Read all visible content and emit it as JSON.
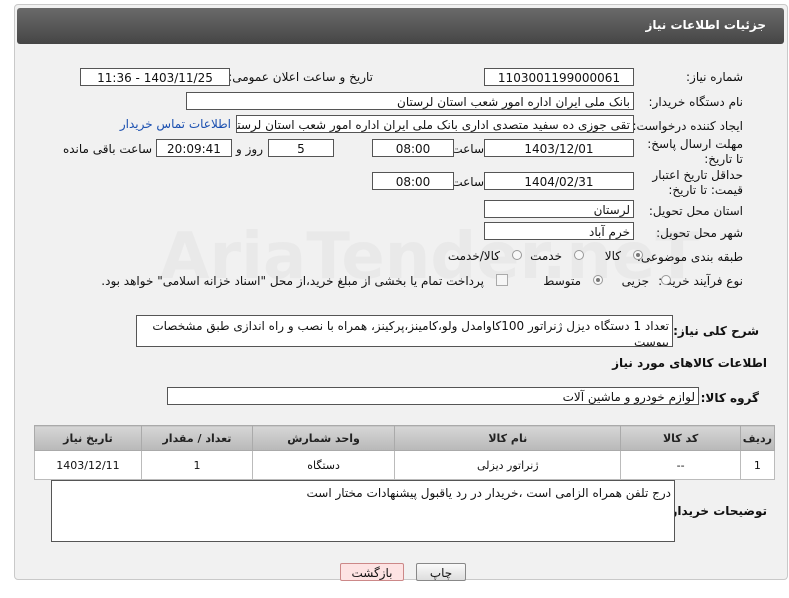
{
  "header": {
    "title": "جزئیات اطلاعات نیاز"
  },
  "fields": {
    "need_number_label": "شماره نیاز:",
    "need_number": "1103001199000061",
    "announce_label": "تاریخ و ساعت اعلان عمومی:",
    "announce_value": "1403/11/25 - 11:36",
    "buyer_org_label": "نام دستگاه خریدار:",
    "buyer_org": "بانک ملی ایران اداره امور شعب استان لرستان",
    "requester_label": "ایجاد کننده درخواست:",
    "requester": "تقی جوزی ده سفید متصدی اداری بانک ملی ایران اداره امور شعب استان لرستان",
    "contact_link": "اطلاعات تماس خریدار",
    "deadline_label": "مهلت ارسال پاسخ: تا تاریخ:",
    "deadline_date": "1403/12/01",
    "time_label": "ساعت",
    "deadline_time": "08:00",
    "days_value": "5",
    "days_label": "روز و",
    "remaining_time": "20:09:41",
    "remaining_label": "ساعت باقی مانده",
    "min_validity_label": "حداقل تاریخ اعتبار قیمت: تا تاریخ:",
    "validity_date": "1404/02/31",
    "validity_time": "08:00",
    "province_label": "استان محل تحویل:",
    "province": "لرستان",
    "city_label": "شهر محل تحویل:",
    "city": "خرم آباد",
    "category_label": "طبقه بندی موضوعی:",
    "category_options": [
      "کالا",
      "خدمت",
      "کالا/خدمت"
    ],
    "purchase_type_label": "نوع فرآیند خرید :",
    "purchase_options": [
      "جزیی",
      "متوسط"
    ],
    "payment_note": "پرداخت تمام یا بخشی از مبلغ خرید،از محل \"اسناد خزانه اسلامی\" خواهد بود.",
    "description_label": "شرح کلی نیاز:",
    "description": "تعداد 1 دستگاه دیزل ژنراتور 100کاوامدل ولو،کامینز،پرکینز، همراه با نصب و راه اندازی طبق مشخصات پیوست"
  },
  "goods": {
    "section_title": "اطلاعات کالاهای مورد نیاز",
    "group_label": "گروه کالا:",
    "group_value": "لوازم خودرو و ماشین آلات",
    "columns": [
      "ردیف",
      "کد کالا",
      "نام کالا",
      "واحد شمارش",
      "تعداد / مقدار",
      "تاریخ نیاز"
    ],
    "rows": [
      [
        "1",
        "--",
        "ژنراتور دیزلی",
        "دستگاه",
        "1",
        "1403/12/11"
      ]
    ]
  },
  "notes": {
    "label": "توضیحات خریدار:",
    "text": "درج تلفن همراه الزامی است ،خریدار در رد یاقبول پیشنهادات مختار است"
  },
  "buttons": {
    "print": "چاپ",
    "back": "بازگشت"
  },
  "colors": {
    "header": "#555555",
    "link": "#1a4fb0",
    "back_button_bg": "#fde3e3"
  }
}
